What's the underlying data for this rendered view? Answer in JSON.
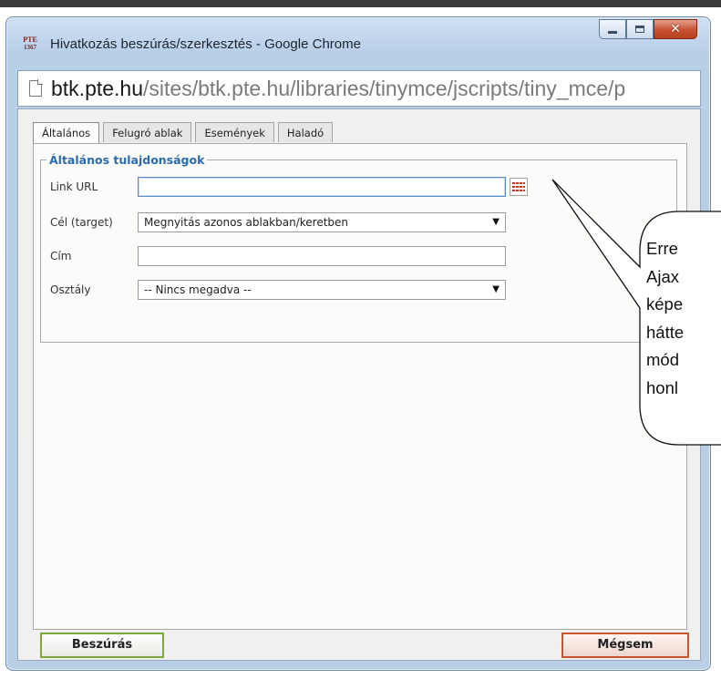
{
  "window": {
    "app_icon_text": [
      "PTE",
      "1367"
    ],
    "title": "Hivatkozás beszúrás/szerkesztés - Google Chrome",
    "controls": {
      "minimize": "minimize-icon",
      "maximize": "maximize-icon",
      "close": "close-icon"
    }
  },
  "urlbar": {
    "host": "btk.pte.hu",
    "path": "/sites/btk.pte.hu/libraries/tinymce/jscripts/tiny_mce/p"
  },
  "tabs": [
    {
      "label": "Általános",
      "active": true
    },
    {
      "label": "Felugró ablak",
      "active": false
    },
    {
      "label": "Események",
      "active": false
    },
    {
      "label": "Haladó",
      "active": false
    }
  ],
  "fieldset": {
    "legend": "Általános tulajdonságok",
    "fields": {
      "link_url": {
        "label": "Link URL",
        "value": ""
      },
      "target": {
        "label": "Cél (target)",
        "value": "Megnyitás azonos ablakban/keretben"
      },
      "title": {
        "label": "Cím",
        "value": ""
      },
      "class": {
        "label": "Osztály",
        "value": "-- Nincs megadva --"
      }
    },
    "browse_icon": "browse-icon"
  },
  "buttons": {
    "insert": "Beszúrás",
    "cancel": "Mégsem"
  },
  "callout": {
    "lines": [
      "Erre",
      "Ajax",
      "képe",
      "hátte",
      "mód",
      "honl"
    ]
  },
  "colors": {
    "legend": "#2b6cb0",
    "insert_border": "#7ea63a",
    "cancel_border": "#c9542e",
    "close_button": "#c6502f"
  }
}
